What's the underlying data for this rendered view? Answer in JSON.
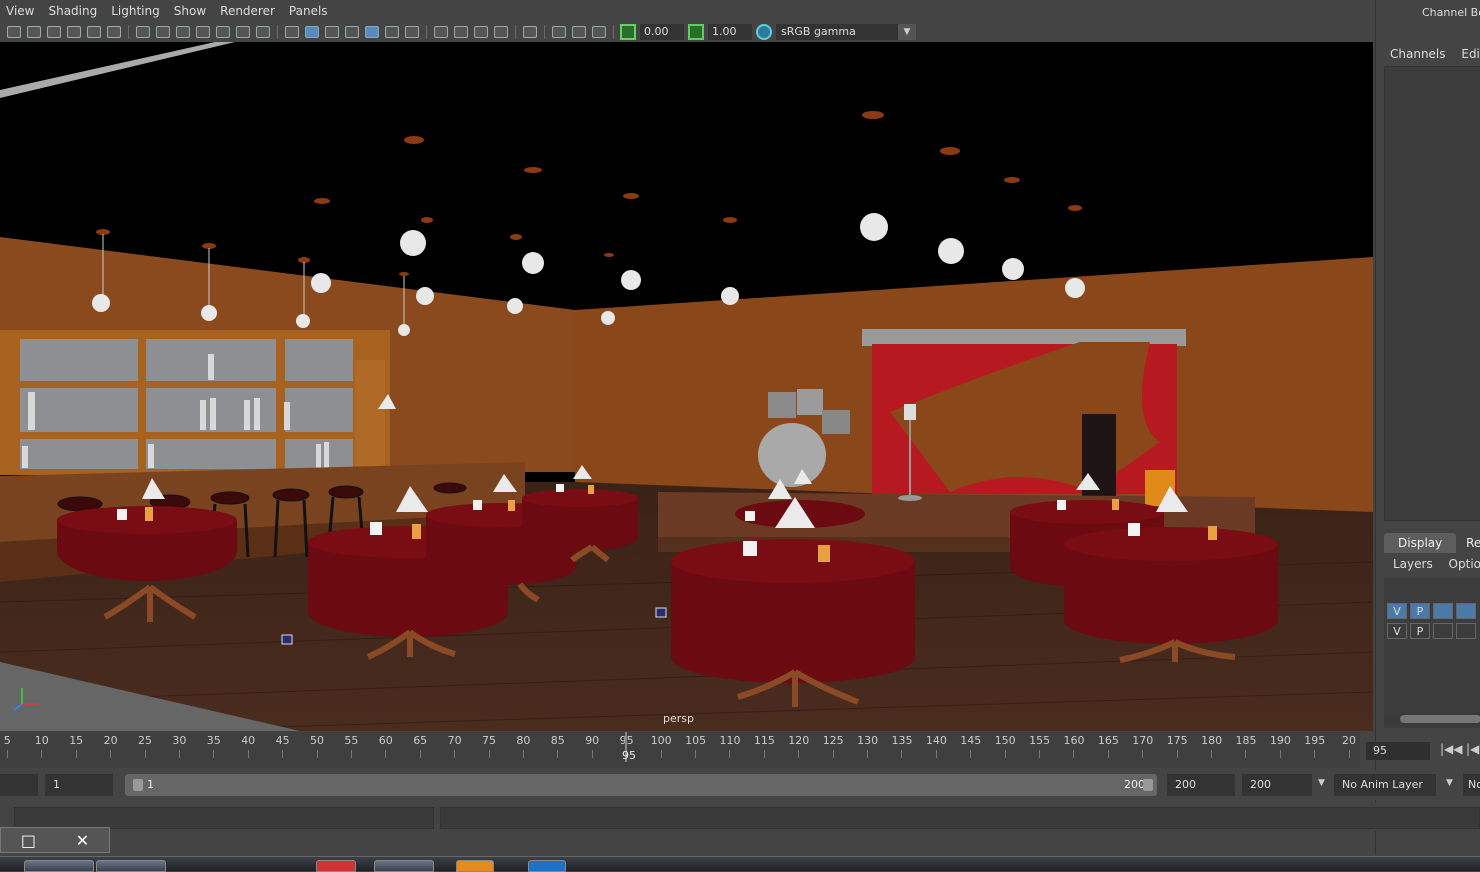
{
  "menus": [
    "View",
    "Shading",
    "Lighting",
    "Show",
    "Renderer",
    "Panels"
  ],
  "toolbar": {
    "exposure_value": "0.00",
    "gamma_value": "1.00",
    "colorspace": "sRGB gamma"
  },
  "viewport": {
    "camera_label": "persp"
  },
  "channel_box": {
    "title": "Channel Box",
    "tabs": [
      "Channels",
      "Edit"
    ]
  },
  "layer_editor": {
    "tabs": [
      "Display",
      "Ren"
    ],
    "menu": [
      "Layers",
      "Options"
    ],
    "rows": [
      {
        "v": "V",
        "p": "P"
      },
      {
        "v": "V",
        "p": "P"
      }
    ]
  },
  "timeline": {
    "ticks": [
      "5",
      "10",
      "15",
      "20",
      "25",
      "30",
      "35",
      "40",
      "45",
      "50",
      "55",
      "60",
      "65",
      "70",
      "75",
      "80",
      "85",
      "90",
      "95",
      "100",
      "105",
      "110",
      "115",
      "120",
      "125",
      "130",
      "135",
      "140",
      "145",
      "150",
      "155",
      "160",
      "165",
      "170",
      "175",
      "180",
      "185",
      "190",
      "195",
      "20"
    ],
    "current_frame_marker": "95",
    "current_frame_field": "95"
  },
  "range": {
    "start_field": "1",
    "slider_start": "1",
    "slider_end": "200",
    "end_field": "200",
    "end_field_2": "200",
    "anim_layer": "No Anim Layer",
    "extra": "No"
  },
  "window_buttons": {
    "maximize": "□",
    "close": "✕"
  }
}
